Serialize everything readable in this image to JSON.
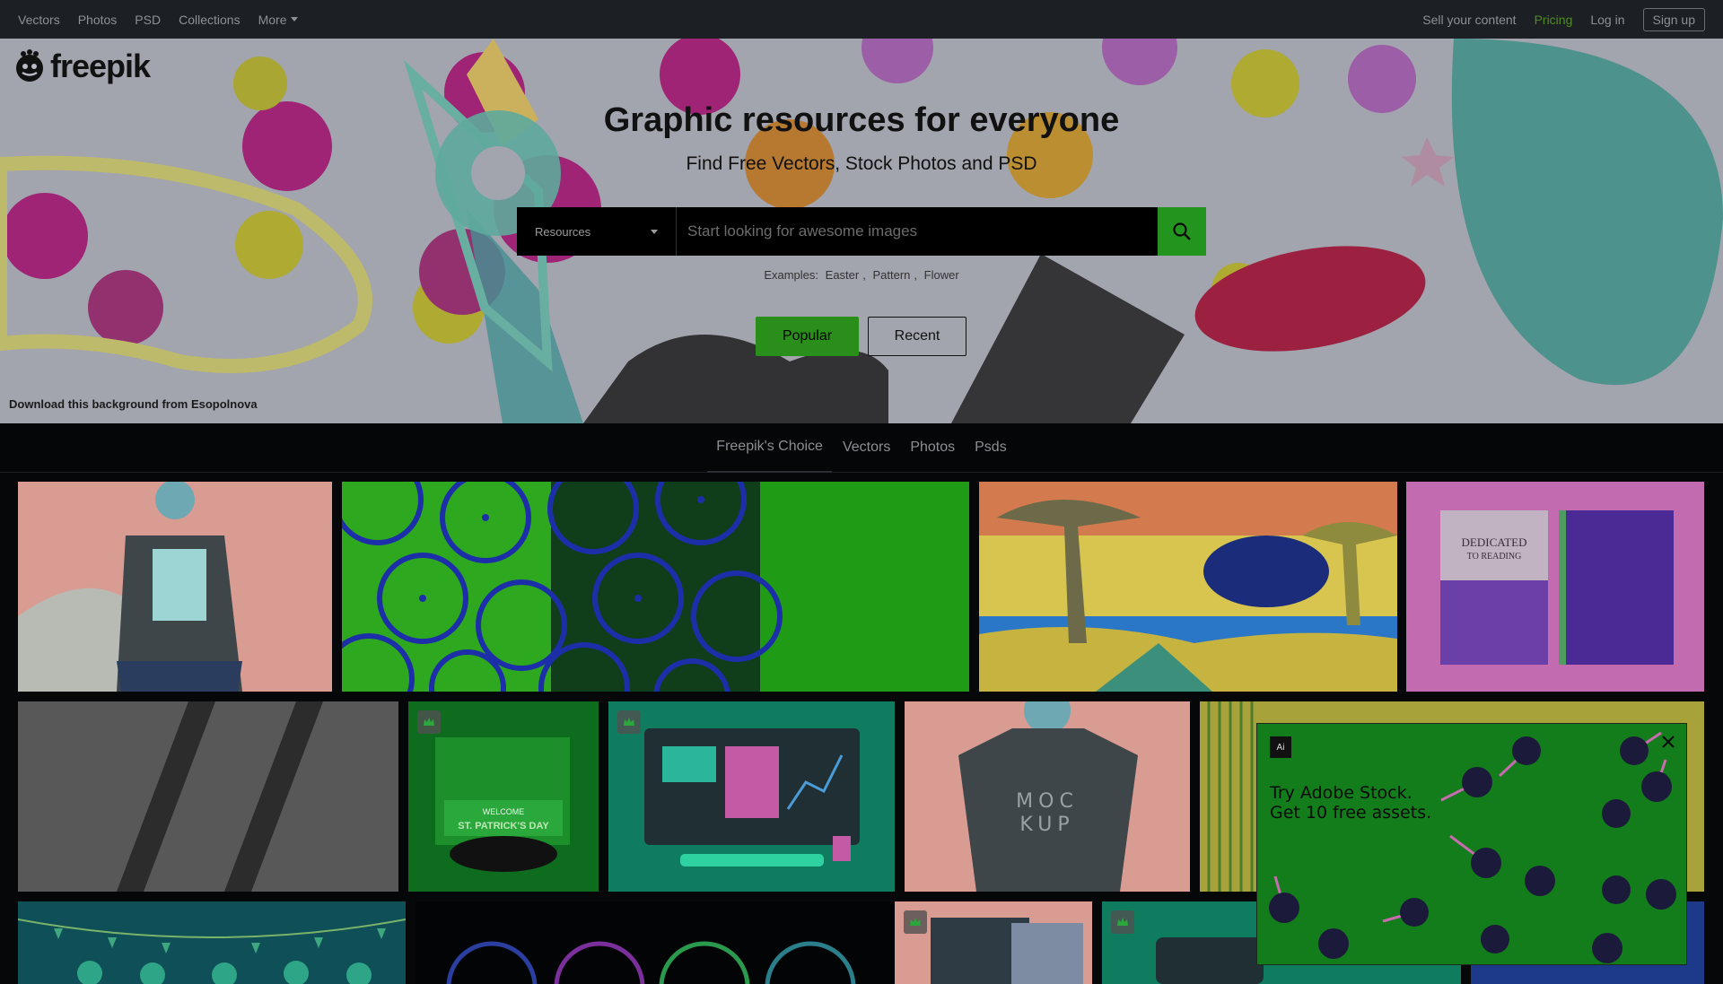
{
  "topnav": {
    "left": [
      "Vectors",
      "Photos",
      "PSD",
      "Collections"
    ],
    "more_label": "More",
    "sell_label": "Sell your content",
    "pricing_label": "Pricing",
    "login_label": "Log in",
    "signup_label": "Sign up"
  },
  "hero": {
    "logo_text": "freepik",
    "title": "Graphic resources for everyone",
    "subtitle": "Find Free Vectors, Stock Photos and PSD",
    "search_select": "Resources",
    "search_placeholder": "Start looking for awesome images",
    "examples_label": "Examples:",
    "examples": [
      "Easter",
      "Pattern",
      "Flower"
    ],
    "popular_label": "Popular",
    "recent_label": "Recent",
    "credit": "Download this background from Esopolnova"
  },
  "tabs": [
    "Freepik's Choice",
    "Vectors",
    "Photos",
    "Psds"
  ],
  "tiles": {
    "mockup_text_1": "MOC",
    "mockup_text_2": "KUP",
    "book_title": "DEDICATED",
    "book_title_2": "TO READING",
    "patrick_1": "WELCOME",
    "patrick_2": "ST. PATRICK'S DAY"
  },
  "ad": {
    "logo": "Ai",
    "line1": "Try Adobe Stock.",
    "line2": "Get 10 free assets."
  },
  "colors": {
    "nav_bg": "#1c2024",
    "accent_green": "#23951f",
    "page_bg": "#060708"
  }
}
